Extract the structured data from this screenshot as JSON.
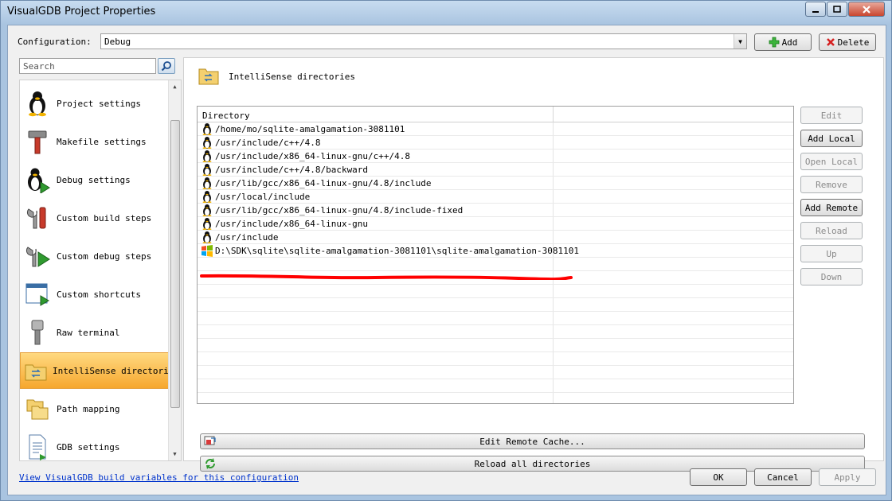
{
  "window": {
    "title": "VisualGDB Project Properties"
  },
  "config": {
    "label": "Configuration:",
    "value": "Debug",
    "add_label": "Add",
    "delete_label": "Delete"
  },
  "search": {
    "placeholder": "Search"
  },
  "nav": {
    "items": [
      {
        "label": "Project settings",
        "icon": "linux-penguin-icon"
      },
      {
        "label": "Makefile settings",
        "icon": "hammer-icon"
      },
      {
        "label": "Debug settings",
        "icon": "penguin-play-icon"
      },
      {
        "label": "Custom build steps",
        "icon": "tools-icon"
      },
      {
        "label": "Custom debug steps",
        "icon": "wrench-play-icon"
      },
      {
        "label": "Custom shortcuts",
        "icon": "window-shortcut-icon"
      },
      {
        "label": "Raw terminal",
        "icon": "serial-cable-icon"
      },
      {
        "label": "IntelliSense directories",
        "icon": "folder-swap-icon",
        "selected": true
      },
      {
        "label": "Path mapping",
        "icon": "folders-icon"
      },
      {
        "label": "GDB settings",
        "icon": "document-icon"
      }
    ]
  },
  "panel": {
    "title": "IntelliSense directories",
    "column_header": "Directory",
    "rows": [
      {
        "path": "/home/mo/sqlite-amalgamation-3081101",
        "icon": "linux-penguin-icon"
      },
      {
        "path": "/usr/include/c++/4.8",
        "icon": "linux-penguin-icon"
      },
      {
        "path": "/usr/include/x86_64-linux-gnu/c++/4.8",
        "icon": "linux-penguin-icon"
      },
      {
        "path": "/usr/include/c++/4.8/backward",
        "icon": "linux-penguin-icon"
      },
      {
        "path": "/usr/lib/gcc/x86_64-linux-gnu/4.8/include",
        "icon": "linux-penguin-icon"
      },
      {
        "path": "/usr/local/include",
        "icon": "linux-penguin-icon"
      },
      {
        "path": "/usr/lib/gcc/x86_64-linux-gnu/4.8/include-fixed",
        "icon": "linux-penguin-icon"
      },
      {
        "path": "/usr/include/x86_64-linux-gnu",
        "icon": "linux-penguin-icon"
      },
      {
        "path": "/usr/include",
        "icon": "linux-penguin-icon"
      },
      {
        "path": "D:\\SDK\\sqlite\\sqlite-amalgamation-3081101\\sqlite-amalgamation-3081101",
        "icon": "windows-flag-icon"
      }
    ],
    "side_buttons": [
      {
        "label": "Edit",
        "enabled": false
      },
      {
        "label": "Add Local",
        "enabled": true
      },
      {
        "label": "Open Local",
        "enabled": false
      },
      {
        "label": "Remove",
        "enabled": false
      },
      {
        "label": "Add Remote",
        "enabled": true
      },
      {
        "label": "Reload",
        "enabled": false
      },
      {
        "label": "Up",
        "enabled": false
      },
      {
        "label": "Down",
        "enabled": false
      }
    ],
    "edit_cache_label": "Edit Remote Cache...",
    "reload_all_label": "Reload all directories"
  },
  "footer": {
    "link_text": "View VisualGDB build variables for this configuration",
    "ok_label": "OK",
    "cancel_label": "Cancel",
    "apply_label": "Apply"
  },
  "colors": {
    "selection": "#f6a72e",
    "annotation_red": "#ff0000",
    "link": "#0033cc"
  }
}
